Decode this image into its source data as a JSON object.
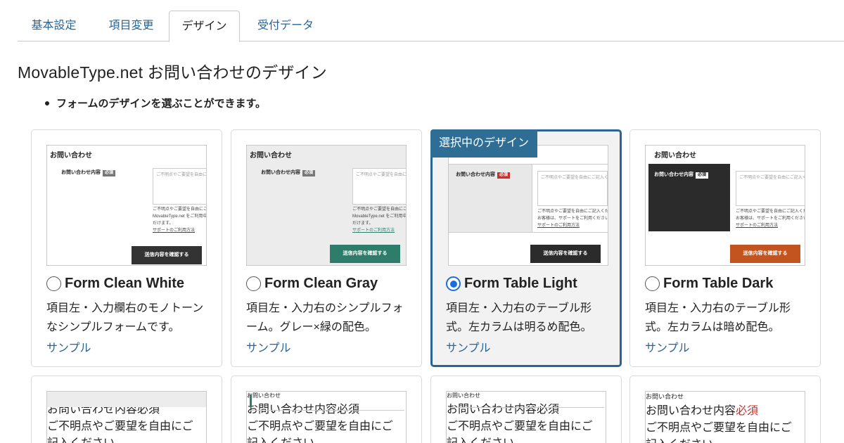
{
  "tabs": [
    {
      "label": "基本設定"
    },
    {
      "label": "項目変更"
    },
    {
      "label": "デザイン"
    },
    {
      "label": "受付データ"
    }
  ],
  "page_title": "MovableType.net お問い合わせのデザイン",
  "note": "フォームのデザインを選ぶことができます。",
  "selected_badge": "選択中のデザイン",
  "preview": {
    "title": "お問い合わせ",
    "field_label": "お問い合わせ内容",
    "required": "必須",
    "placeholder": "ご不明点やご要望を自由にご記入ください",
    "help_line1": "ご不明点やご要望を自由にご記入ください。",
    "help_line2": "MovableType.net をご利用中のお客様は、",
    "help_line2b": "お客様は、サポートをご利用ください。",
    "help_line3": "だけます。",
    "help_link": "サポートのご利用方法",
    "submit": "送信内容を確認する"
  },
  "cards": [
    {
      "name": "Form Clean White",
      "desc": "項目左・入力欄右のモノトーンなシンプルフォームです。",
      "sample": "サンプル",
      "selected": false,
      "accent": "#333333"
    },
    {
      "name": "Form Clean Gray",
      "desc": "項目左・入力右のシンプルフォーム。グレー×緑の配色。",
      "sample": "サンプル",
      "selected": false,
      "accent": "#2e7d6b"
    },
    {
      "name": "Form Table Light",
      "desc": "項目左・入力右のテーブル形式。左カラムは明るめ配色。",
      "sample": "サンプル",
      "selected": true,
      "accent": "#333333"
    },
    {
      "name": "Form Table Dark",
      "desc": "項目左・入力右のテーブル形式。左カラムは暗め配色。",
      "sample": "サンプル",
      "selected": false,
      "accent": "#c4541f"
    }
  ],
  "colors": {
    "link": "#2a6496",
    "badge": "#2e6e95",
    "radio": "#1a6fe0"
  }
}
